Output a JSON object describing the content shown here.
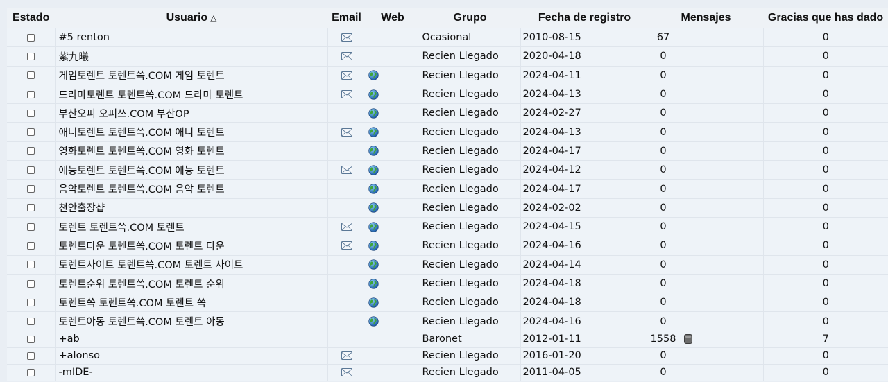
{
  "headers": {
    "estado": "Estado",
    "usuario": "Usuario",
    "sort_indicator": "△",
    "email": "Email",
    "web": "Web",
    "grupo": "Grupo",
    "fecha": "Fecha de registro",
    "mensajes": "Mensajes",
    "gracias": "Gracias que has dado"
  },
  "rows": [
    {
      "user": "#5 renton",
      "email": true,
      "web": false,
      "group": "Ocasional",
      "date": "2010-08-15",
      "posts": "67",
      "pm": false,
      "thanks": "0"
    },
    {
      "user": "紫九曦",
      "email": true,
      "web": false,
      "group": "Recien Llegado",
      "date": "2020-04-18",
      "posts": "0",
      "pm": false,
      "thanks": "0"
    },
    {
      "user": "게임토렌트 토렌트쓱.COM 게임 토렌트",
      "email": true,
      "web": true,
      "group": "Recien Llegado",
      "date": "2024-04-11",
      "posts": "0",
      "pm": false,
      "thanks": "0"
    },
    {
      "user": "드라마토렌트 토렌트쓱.COM 드라마 토렌트",
      "email": true,
      "web": true,
      "group": "Recien Llegado",
      "date": "2024-04-13",
      "posts": "0",
      "pm": false,
      "thanks": "0"
    },
    {
      "user": "부산오피 오피쓰.COM 부산OP",
      "email": false,
      "web": true,
      "group": "Recien Llegado",
      "date": "2024-02-27",
      "posts": "0",
      "pm": false,
      "thanks": "0"
    },
    {
      "user": "애니토렌트 토렌트쓱.COM 애니 토렌트",
      "email": true,
      "web": true,
      "group": "Recien Llegado",
      "date": "2024-04-13",
      "posts": "0",
      "pm": false,
      "thanks": "0"
    },
    {
      "user": "영화토렌트 토렌트쓱.COM 영화 토렌트",
      "email": false,
      "web": true,
      "group": "Recien Llegado",
      "date": "2024-04-17",
      "posts": "0",
      "pm": false,
      "thanks": "0"
    },
    {
      "user": "예능토렌트 토렌트쓱.COM 예능 토렌트",
      "email": true,
      "web": true,
      "group": "Recien Llegado",
      "date": "2024-04-12",
      "posts": "0",
      "pm": false,
      "thanks": "0"
    },
    {
      "user": "음악토렌트 토렌트쓱.COM 음악 토렌트",
      "email": false,
      "web": true,
      "group": "Recien Llegado",
      "date": "2024-04-17",
      "posts": "0",
      "pm": false,
      "thanks": "0"
    },
    {
      "user": "천안출장샵",
      "email": false,
      "web": true,
      "group": "Recien Llegado",
      "date": "2024-02-02",
      "posts": "0",
      "pm": false,
      "thanks": "0"
    },
    {
      "user": "토렌트 토렌트쓱.COM 토렌트",
      "email": true,
      "web": true,
      "group": "Recien Llegado",
      "date": "2024-04-15",
      "posts": "0",
      "pm": false,
      "thanks": "0"
    },
    {
      "user": "토렌트다운 토렌트쓱.COM 토렌트 다운",
      "email": true,
      "web": true,
      "group": "Recien Llegado",
      "date": "2024-04-16",
      "posts": "0",
      "pm": false,
      "thanks": "0"
    },
    {
      "user": "토렌트사이트 토렌트쓱.COM 토렌트 사이트",
      "email": false,
      "web": true,
      "group": "Recien Llegado",
      "date": "2024-04-14",
      "posts": "0",
      "pm": false,
      "thanks": "0"
    },
    {
      "user": "토렌트순위 토렌트쓱.COM 토렌트 순위",
      "email": false,
      "web": true,
      "group": "Recien Llegado",
      "date": "2024-04-18",
      "posts": "0",
      "pm": false,
      "thanks": "0"
    },
    {
      "user": "토렌트쓱 토렌트쓱.COM 토렌트 쓱",
      "email": false,
      "web": true,
      "group": "Recien Llegado",
      "date": "2024-04-18",
      "posts": "0",
      "pm": false,
      "thanks": "0"
    },
    {
      "user": "토렌트야동 토렌트쓱.COM 토렌트 야동",
      "email": false,
      "web": true,
      "group": "Recien Llegado",
      "date": "2024-04-16",
      "posts": "0",
      "pm": false,
      "thanks": "0"
    },
    {
      "user": "+ab",
      "email": false,
      "web": false,
      "group": "Baronet",
      "date": "2012-01-11",
      "posts": "1558",
      "pm": true,
      "thanks": "7"
    },
    {
      "user": "+alonso",
      "email": true,
      "web": false,
      "group": "Recien Llegado",
      "date": "2016-01-20",
      "posts": "0",
      "pm": false,
      "thanks": "0"
    },
    {
      "user": "-mIDE-",
      "email": true,
      "web": false,
      "group": "Recien Llegado",
      "date": "2011-04-05",
      "posts": "0",
      "pm": false,
      "thanks": "0"
    }
  ]
}
